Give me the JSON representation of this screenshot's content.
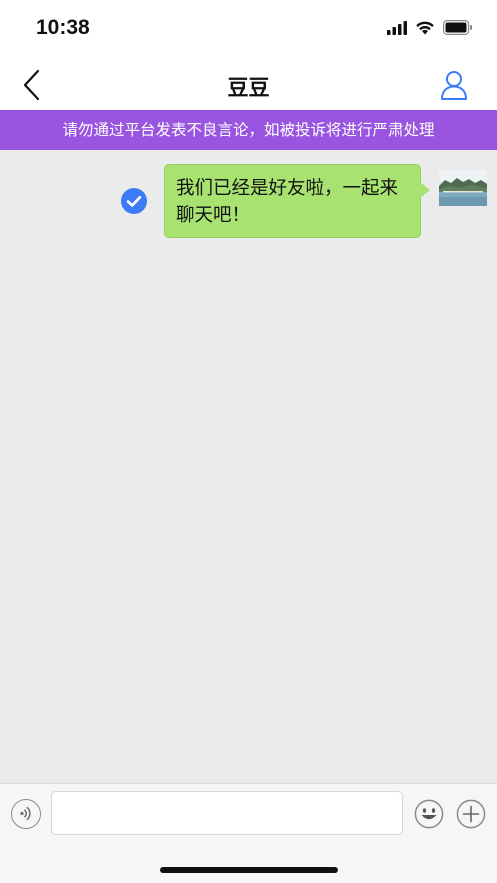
{
  "status_bar": {
    "time": "10:38"
  },
  "nav": {
    "title": "豆豆",
    "icons": [
      "chevron-left-icon",
      "person-icon"
    ],
    "accent_color": "#3b7cf6"
  },
  "notice": {
    "text": "请勿通过平台发表不良言论，如被投诉将进行严肃处理",
    "background": "#9a55e0"
  },
  "messages": [
    {
      "direction": "outgoing",
      "text_line1": "我们已经是好友啦，一起来",
      "text_line2": "聊天吧！",
      "status_icon": "read-check-icon",
      "bubble_color": "#a8e270"
    }
  ],
  "input_bar": {
    "value": "",
    "icons": [
      "voice-icon",
      "emoji-icon",
      "plus-icon"
    ]
  }
}
